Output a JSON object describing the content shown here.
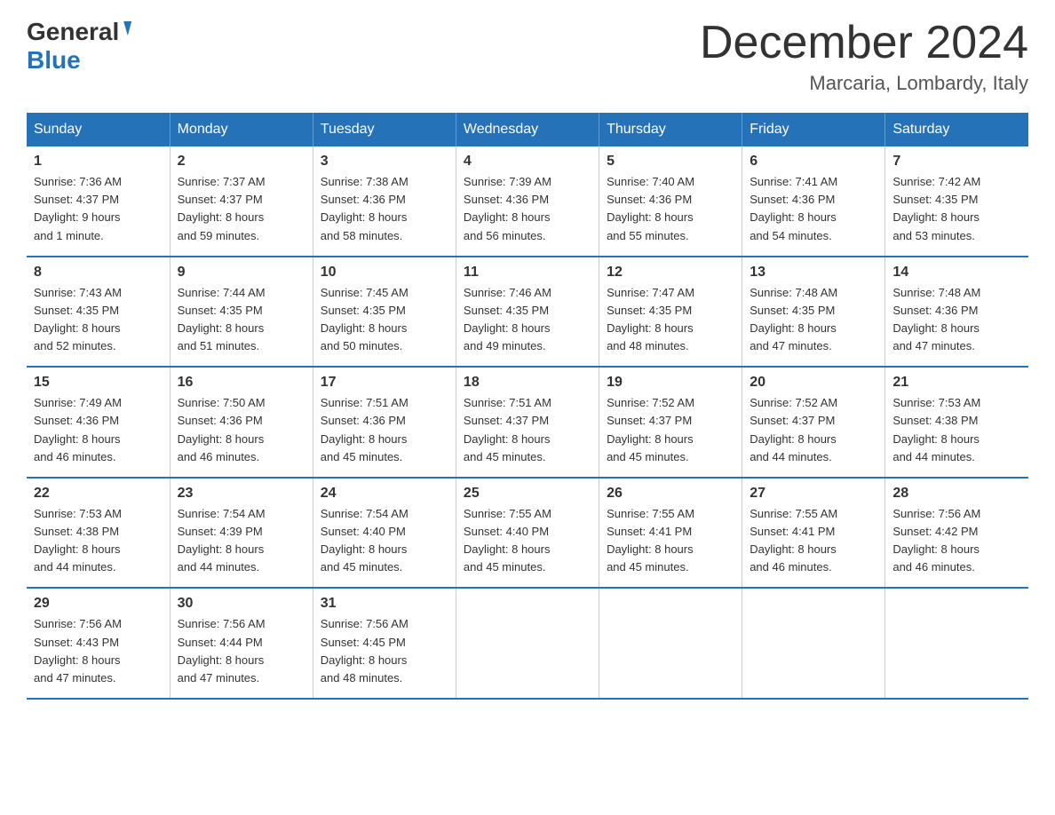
{
  "header": {
    "logo_general": "General",
    "logo_blue": "Blue",
    "month_title": "December 2024",
    "location": "Marcaria, Lombardy, Italy"
  },
  "days_of_week": [
    "Sunday",
    "Monday",
    "Tuesday",
    "Wednesday",
    "Thursday",
    "Friday",
    "Saturday"
  ],
  "weeks": [
    [
      {
        "day": "1",
        "sunrise": "Sunrise: 7:36 AM",
        "sunset": "Sunset: 4:37 PM",
        "daylight": "Daylight: 9 hours",
        "daylight2": "and 1 minute."
      },
      {
        "day": "2",
        "sunrise": "Sunrise: 7:37 AM",
        "sunset": "Sunset: 4:37 PM",
        "daylight": "Daylight: 8 hours",
        "daylight2": "and 59 minutes."
      },
      {
        "day": "3",
        "sunrise": "Sunrise: 7:38 AM",
        "sunset": "Sunset: 4:36 PM",
        "daylight": "Daylight: 8 hours",
        "daylight2": "and 58 minutes."
      },
      {
        "day": "4",
        "sunrise": "Sunrise: 7:39 AM",
        "sunset": "Sunset: 4:36 PM",
        "daylight": "Daylight: 8 hours",
        "daylight2": "and 56 minutes."
      },
      {
        "day": "5",
        "sunrise": "Sunrise: 7:40 AM",
        "sunset": "Sunset: 4:36 PM",
        "daylight": "Daylight: 8 hours",
        "daylight2": "and 55 minutes."
      },
      {
        "day": "6",
        "sunrise": "Sunrise: 7:41 AM",
        "sunset": "Sunset: 4:36 PM",
        "daylight": "Daylight: 8 hours",
        "daylight2": "and 54 minutes."
      },
      {
        "day": "7",
        "sunrise": "Sunrise: 7:42 AM",
        "sunset": "Sunset: 4:35 PM",
        "daylight": "Daylight: 8 hours",
        "daylight2": "and 53 minutes."
      }
    ],
    [
      {
        "day": "8",
        "sunrise": "Sunrise: 7:43 AM",
        "sunset": "Sunset: 4:35 PM",
        "daylight": "Daylight: 8 hours",
        "daylight2": "and 52 minutes."
      },
      {
        "day": "9",
        "sunrise": "Sunrise: 7:44 AM",
        "sunset": "Sunset: 4:35 PM",
        "daylight": "Daylight: 8 hours",
        "daylight2": "and 51 minutes."
      },
      {
        "day": "10",
        "sunrise": "Sunrise: 7:45 AM",
        "sunset": "Sunset: 4:35 PM",
        "daylight": "Daylight: 8 hours",
        "daylight2": "and 50 minutes."
      },
      {
        "day": "11",
        "sunrise": "Sunrise: 7:46 AM",
        "sunset": "Sunset: 4:35 PM",
        "daylight": "Daylight: 8 hours",
        "daylight2": "and 49 minutes."
      },
      {
        "day": "12",
        "sunrise": "Sunrise: 7:47 AM",
        "sunset": "Sunset: 4:35 PM",
        "daylight": "Daylight: 8 hours",
        "daylight2": "and 48 minutes."
      },
      {
        "day": "13",
        "sunrise": "Sunrise: 7:48 AM",
        "sunset": "Sunset: 4:35 PM",
        "daylight": "Daylight: 8 hours",
        "daylight2": "and 47 minutes."
      },
      {
        "day": "14",
        "sunrise": "Sunrise: 7:48 AM",
        "sunset": "Sunset: 4:36 PM",
        "daylight": "Daylight: 8 hours",
        "daylight2": "and 47 minutes."
      }
    ],
    [
      {
        "day": "15",
        "sunrise": "Sunrise: 7:49 AM",
        "sunset": "Sunset: 4:36 PM",
        "daylight": "Daylight: 8 hours",
        "daylight2": "and 46 minutes."
      },
      {
        "day": "16",
        "sunrise": "Sunrise: 7:50 AM",
        "sunset": "Sunset: 4:36 PM",
        "daylight": "Daylight: 8 hours",
        "daylight2": "and 46 minutes."
      },
      {
        "day": "17",
        "sunrise": "Sunrise: 7:51 AM",
        "sunset": "Sunset: 4:36 PM",
        "daylight": "Daylight: 8 hours",
        "daylight2": "and 45 minutes."
      },
      {
        "day": "18",
        "sunrise": "Sunrise: 7:51 AM",
        "sunset": "Sunset: 4:37 PM",
        "daylight": "Daylight: 8 hours",
        "daylight2": "and 45 minutes."
      },
      {
        "day": "19",
        "sunrise": "Sunrise: 7:52 AM",
        "sunset": "Sunset: 4:37 PM",
        "daylight": "Daylight: 8 hours",
        "daylight2": "and 45 minutes."
      },
      {
        "day": "20",
        "sunrise": "Sunrise: 7:52 AM",
        "sunset": "Sunset: 4:37 PM",
        "daylight": "Daylight: 8 hours",
        "daylight2": "and 44 minutes."
      },
      {
        "day": "21",
        "sunrise": "Sunrise: 7:53 AM",
        "sunset": "Sunset: 4:38 PM",
        "daylight": "Daylight: 8 hours",
        "daylight2": "and 44 minutes."
      }
    ],
    [
      {
        "day": "22",
        "sunrise": "Sunrise: 7:53 AM",
        "sunset": "Sunset: 4:38 PM",
        "daylight": "Daylight: 8 hours",
        "daylight2": "and 44 minutes."
      },
      {
        "day": "23",
        "sunrise": "Sunrise: 7:54 AM",
        "sunset": "Sunset: 4:39 PM",
        "daylight": "Daylight: 8 hours",
        "daylight2": "and 44 minutes."
      },
      {
        "day": "24",
        "sunrise": "Sunrise: 7:54 AM",
        "sunset": "Sunset: 4:40 PM",
        "daylight": "Daylight: 8 hours",
        "daylight2": "and 45 minutes."
      },
      {
        "day": "25",
        "sunrise": "Sunrise: 7:55 AM",
        "sunset": "Sunset: 4:40 PM",
        "daylight": "Daylight: 8 hours",
        "daylight2": "and 45 minutes."
      },
      {
        "day": "26",
        "sunrise": "Sunrise: 7:55 AM",
        "sunset": "Sunset: 4:41 PM",
        "daylight": "Daylight: 8 hours",
        "daylight2": "and 45 minutes."
      },
      {
        "day": "27",
        "sunrise": "Sunrise: 7:55 AM",
        "sunset": "Sunset: 4:41 PM",
        "daylight": "Daylight: 8 hours",
        "daylight2": "and 46 minutes."
      },
      {
        "day": "28",
        "sunrise": "Sunrise: 7:56 AM",
        "sunset": "Sunset: 4:42 PM",
        "daylight": "Daylight: 8 hours",
        "daylight2": "and 46 minutes."
      }
    ],
    [
      {
        "day": "29",
        "sunrise": "Sunrise: 7:56 AM",
        "sunset": "Sunset: 4:43 PM",
        "daylight": "Daylight: 8 hours",
        "daylight2": "and 47 minutes."
      },
      {
        "day": "30",
        "sunrise": "Sunrise: 7:56 AM",
        "sunset": "Sunset: 4:44 PM",
        "daylight": "Daylight: 8 hours",
        "daylight2": "and 47 minutes."
      },
      {
        "day": "31",
        "sunrise": "Sunrise: 7:56 AM",
        "sunset": "Sunset: 4:45 PM",
        "daylight": "Daylight: 8 hours",
        "daylight2": "and 48 minutes."
      },
      null,
      null,
      null,
      null
    ]
  ]
}
